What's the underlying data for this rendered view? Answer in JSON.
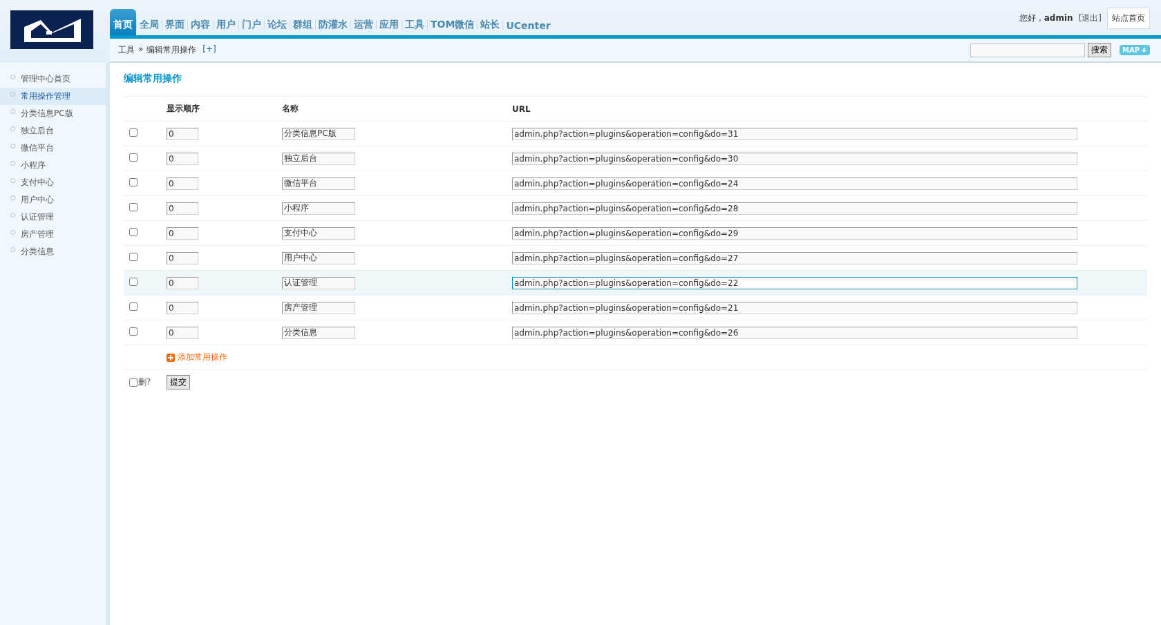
{
  "nav": [
    {
      "label": "首页",
      "selected": true
    },
    {
      "label": "全局",
      "selected": false
    },
    {
      "label": "界面",
      "selected": false
    },
    {
      "label": "内容",
      "selected": false
    },
    {
      "label": "用户",
      "selected": false
    },
    {
      "label": "门户",
      "selected": false
    },
    {
      "label": "论坛",
      "selected": false
    },
    {
      "label": "群组",
      "selected": false
    },
    {
      "label": "防灌水",
      "selected": false
    },
    {
      "label": "运营",
      "selected": false
    },
    {
      "label": "应用",
      "selected": false
    },
    {
      "label": "工具",
      "selected": false
    },
    {
      "label": "TOM微信",
      "selected": false
    },
    {
      "label": "站长",
      "selected": false
    },
    {
      "label": "UCenter",
      "selected": false
    }
  ],
  "user": {
    "greeting": "您好，",
    "name": "admin",
    "logout": "[退出]",
    "home_button": "站点首页"
  },
  "breadcrumb": {
    "parent": "工具",
    "separator": "»",
    "current": "编辑常用操作",
    "add": "[+]"
  },
  "search": {
    "button": "搜索",
    "map": "MAP"
  },
  "sidebar": [
    {
      "label": "管理中心首页",
      "selected": false
    },
    {
      "label": "常用操作管理",
      "selected": true
    },
    {
      "label": "分类信息PC版",
      "selected": false
    },
    {
      "label": "独立后台",
      "selected": false
    },
    {
      "label": "微信平台",
      "selected": false
    },
    {
      "label": "小程序",
      "selected": false
    },
    {
      "label": "支付中心",
      "selected": false
    },
    {
      "label": "用户中心",
      "selected": false
    },
    {
      "label": "认证管理",
      "selected": false
    },
    {
      "label": "房产管理",
      "selected": false
    },
    {
      "label": "分类信息",
      "selected": false
    }
  ],
  "title": "编辑常用操作",
  "table": {
    "columns": [
      "显示顺序",
      "名称",
      "URL"
    ],
    "rows": [
      {
        "checked": false,
        "highlighted": false,
        "order": "0",
        "name": "分类信息PC版",
        "url": "admin.php?action=plugins&operation=config&do=31"
      },
      {
        "checked": false,
        "highlighted": false,
        "order": "0",
        "name": "独立后台",
        "url": "admin.php?action=plugins&operation=config&do=30"
      },
      {
        "checked": false,
        "highlighted": false,
        "order": "0",
        "name": "微信平台",
        "url": "admin.php?action=plugins&operation=config&do=24"
      },
      {
        "checked": false,
        "highlighted": false,
        "order": "0",
        "name": "小程序",
        "url": "admin.php?action=plugins&operation=config&do=28"
      },
      {
        "checked": false,
        "highlighted": false,
        "order": "0",
        "name": "支付中心",
        "url": "admin.php?action=plugins&operation=config&do=29"
      },
      {
        "checked": false,
        "highlighted": false,
        "order": "0",
        "name": "用户中心",
        "url": "admin.php?action=plugins&operation=config&do=27"
      },
      {
        "checked": false,
        "highlighted": true,
        "order": "0",
        "name": "认证管理",
        "url": "admin.php?action=plugins&operation=config&do=22"
      },
      {
        "checked": false,
        "highlighted": false,
        "order": "0",
        "name": "房产管理",
        "url": "admin.php?action=plugins&operation=config&do=21"
      },
      {
        "checked": false,
        "highlighted": false,
        "order": "0",
        "name": "分类信息",
        "url": "admin.php?action=plugins&operation=config&do=26"
      }
    ],
    "add_link": "添加常用操作"
  },
  "footer": {
    "delete_label": "删?",
    "delete_checked": false,
    "submit": "提交"
  }
}
